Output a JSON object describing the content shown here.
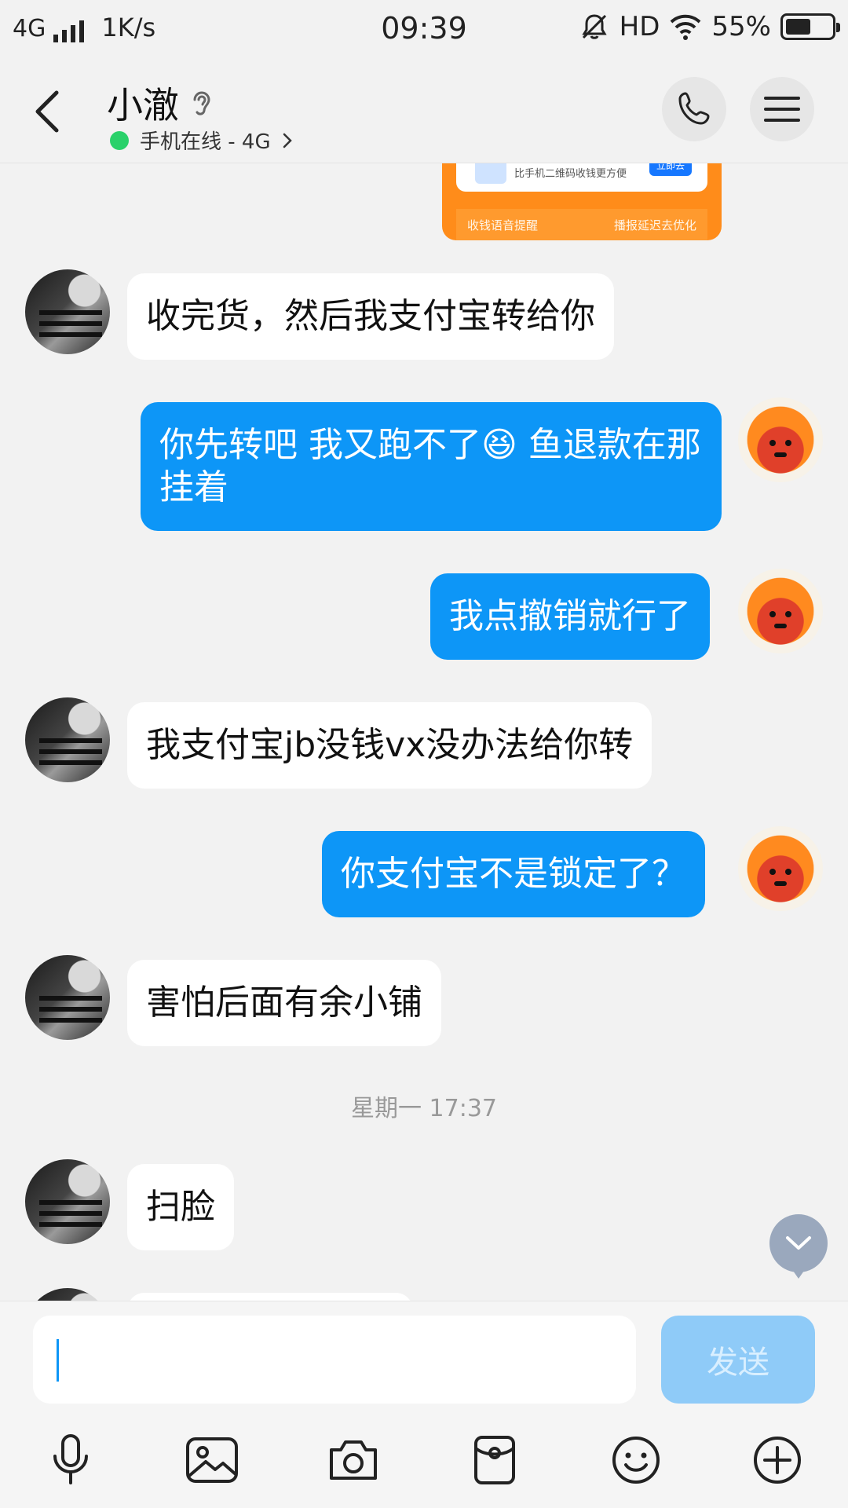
{
  "status_bar": {
    "network": "4G",
    "speed": "1K/s",
    "time": "09:39",
    "hd": "HD",
    "battery": "55%",
    "battery_level": 0.55
  },
  "header": {
    "contact_name": "小澈",
    "online_status": "手机在线 - 4G",
    "online_color": "#2ad16a"
  },
  "card": {
    "line": "比手机二维码收钱更方便",
    "button": "立即去",
    "strip_left": "收钱语音提醒",
    "strip_right": "播报延迟去优化"
  },
  "messages": [
    {
      "side": "left",
      "text": "收完货，然后我支付宝转给你"
    },
    {
      "side": "right",
      "text_before": "你先转吧 我又跑不了",
      "emoji": "😆",
      "text_after": " 鱼退款在那挂着"
    },
    {
      "side": "right",
      "text": "我点撤销就行了"
    },
    {
      "side": "left",
      "text": "我支付宝jb没钱vx没办法给你转"
    },
    {
      "side": "right",
      "text": "你支付宝不是锁定了？"
    },
    {
      "side": "left",
      "text": "害怕后面有余小铺"
    },
    {
      "side": "left",
      "text": "扫脸"
    }
  ],
  "timestamp": "星期一 17:37",
  "input": {
    "value": "",
    "send_label": "发送"
  },
  "toolbar": {
    "icons": [
      "microphone-icon",
      "image-icon",
      "camera-icon",
      "red-packet-icon",
      "emoji-icon",
      "plus-icon"
    ]
  },
  "colors": {
    "accent": "#0d96f7",
    "send_disabled": "#8fcbf8",
    "background": "#f2f2f2"
  }
}
